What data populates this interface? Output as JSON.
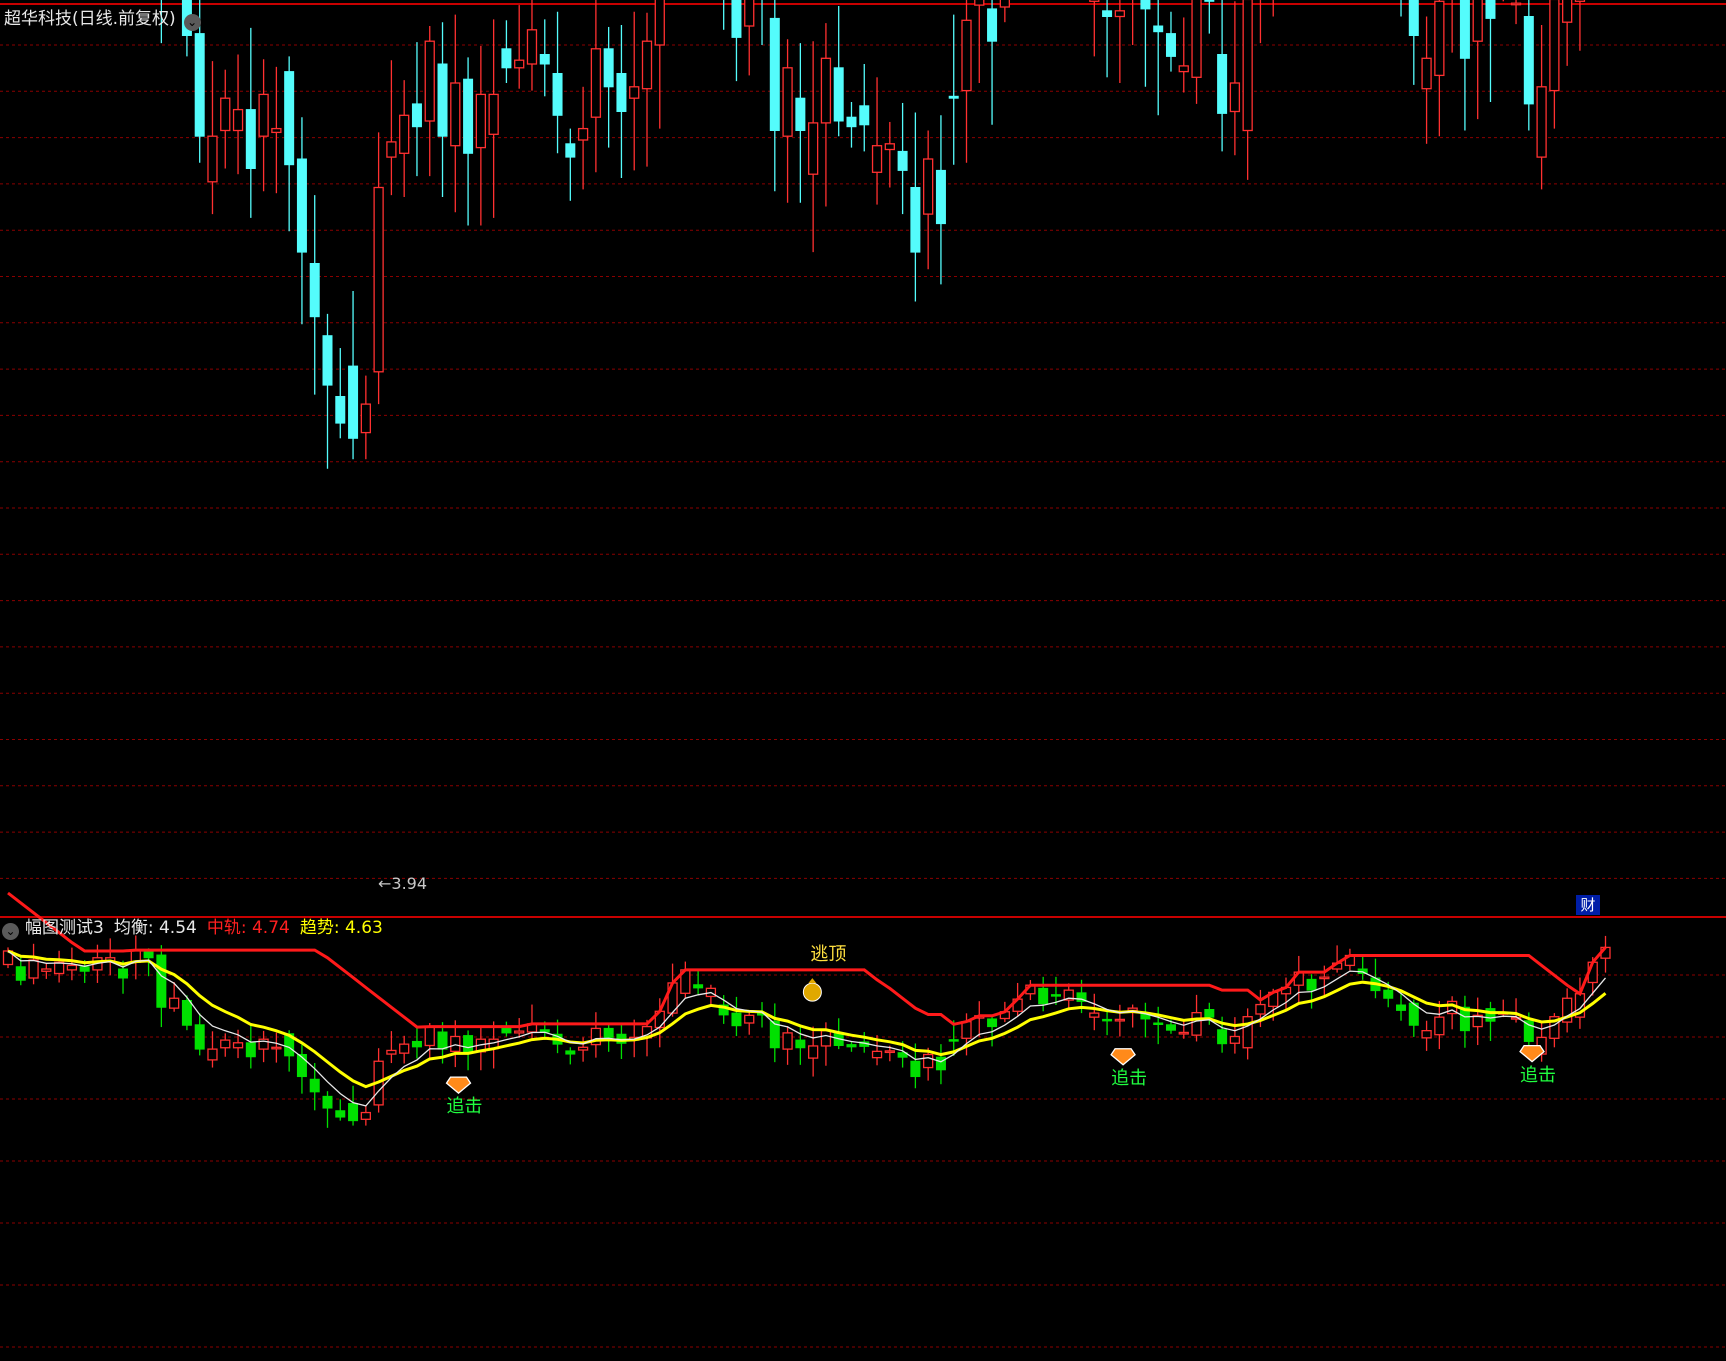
{
  "chart_data": [
    {
      "type": "candlestick",
      "title": "超华科技(日线.前复权)",
      "min_label": "3.94",
      "candles": [
        {
          "o": 5.9,
          "c": 6.2
        },
        {
          "o": 5.85,
          "c": 5.55
        },
        {
          "o": 5.6,
          "c": 6.0
        },
        {
          "o": 5.75,
          "c": 5.8
        },
        {
          "o": 5.7,
          "c": 5.95
        },
        {
          "o": 5.78,
          "c": 5.88
        },
        {
          "o": 5.85,
          "c": 5.75
        },
        {
          "o": 5.78,
          "c": 6.05
        },
        {
          "o": 5.98,
          "c": 6.05
        },
        {
          "o": 5.8,
          "c": 5.6
        },
        {
          "o": 5.95,
          "c": 6.22
        },
        {
          "o": 6.18,
          "c": 6.05
        },
        {
          "o": 6.11,
          "c": 4.95
        },
        {
          "o": 4.93,
          "c": 5.15
        },
        {
          "o": 5.1,
          "c": 4.55
        },
        {
          "o": 4.56,
          "c": 4.02
        },
        {
          "o": 3.78,
          "c": 4.02
        },
        {
          "o": 4.05,
          "c": 4.22
        },
        {
          "o": 4.05,
          "c": 4.16
        },
        {
          "o": 4.16,
          "c": 3.85
        },
        {
          "o": 4.02,
          "c": 4.24
        },
        {
          "o": 4.04,
          "c": 4.06
        },
        {
          "o": 4.36,
          "c": 3.87
        },
        {
          "o": 3.9,
          "c": 3.41
        },
        {
          "o": 3.35,
          "c": 3.07
        },
        {
          "o": 2.97,
          "c": 2.71
        },
        {
          "o": 2.65,
          "c": 2.51
        },
        {
          "o": 2.81,
          "c": 2.43
        },
        {
          "o": 2.46,
          "c": 2.61
        },
        {
          "o": 2.78,
          "c": 3.75
        },
        {
          "o": 3.91,
          "c": 3.99
        },
        {
          "o": 3.93,
          "c": 4.13
        },
        {
          "o": 4.19,
          "c": 4.07
        },
        {
          "o": 4.1,
          "c": 4.52
        },
        {
          "o": 4.4,
          "c": 4.02
        },
        {
          "o": 3.97,
          "c": 4.3
        },
        {
          "o": 4.32,
          "c": 3.93
        },
        {
          "o": 3.96,
          "c": 4.24
        },
        {
          "o": 4.03,
          "c": 4.24
        },
        {
          "o": 4.48,
          "c": 4.38
        },
        {
          "o": 4.38,
          "c": 4.42
        },
        {
          "o": 4.4,
          "c": 4.58
        },
        {
          "o": 4.45,
          "c": 4.4
        },
        {
          "o": 4.35,
          "c": 4.13
        },
        {
          "o": 3.98,
          "c": 3.91
        },
        {
          "o": 4.0,
          "c": 4.06
        },
        {
          "o": 4.12,
          "c": 4.48
        },
        {
          "o": 4.48,
          "c": 4.28
        },
        {
          "o": 4.35,
          "c": 4.15
        },
        {
          "o": 4.22,
          "c": 4.28
        },
        {
          "o": 4.27,
          "c": 4.52
        },
        {
          "o": 4.5,
          "c": 4.86
        },
        {
          "o": 4.82,
          "c": 5.49
        },
        {
          "o": 5.26,
          "c": 5.78
        },
        {
          "o": 5.45,
          "c": 5.38
        },
        {
          "o": 5.19,
          "c": 5.37
        },
        {
          "o": 5.0,
          "c": 4.78
        },
        {
          "o": 4.82,
          "c": 4.54
        },
        {
          "o": 4.6,
          "c": 4.77
        },
        {
          "o": 4.81,
          "c": 4.79
        },
        {
          "o": 4.64,
          "c": 4.05
        },
        {
          "o": 4.02,
          "c": 4.38
        },
        {
          "o": 4.22,
          "c": 4.05
        },
        {
          "o": 3.82,
          "c": 4.09
        },
        {
          "o": 4.09,
          "c": 4.43
        },
        {
          "o": 4.38,
          "c": 4.1
        },
        {
          "o": 4.12,
          "c": 4.07
        },
        {
          "o": 4.18,
          "c": 4.08
        },
        {
          "o": 3.83,
          "c": 3.97
        },
        {
          "o": 3.95,
          "c": 3.98
        },
        {
          "o": 3.94,
          "c": 3.84
        },
        {
          "o": 3.75,
          "c": 3.41
        },
        {
          "o": 3.61,
          "c": 3.9
        },
        {
          "o": 3.84,
          "c": 3.56
        },
        {
          "o": 4.23,
          "c": 4.22
        },
        {
          "o": 4.26,
          "c": 4.63
        },
        {
          "o": 4.71,
          "c": 4.76
        },
        {
          "o": 4.69,
          "c": 4.52
        },
        {
          "o": 4.7,
          "c": 4.85
        },
        {
          "o": 4.86,
          "c": 5.13
        },
        {
          "o": 5.25,
          "c": 5.44
        },
        {
          "o": 5.37,
          "c": 5.03
        },
        {
          "o": 5.23,
          "c": 5.2
        },
        {
          "o": 5.11,
          "c": 5.33
        },
        {
          "o": 5.27,
          "c": 5.08
        },
        {
          "o": 4.73,
          "c": 4.82
        },
        {
          "o": 4.68,
          "c": 4.65
        },
        {
          "o": 4.65,
          "c": 4.68
        },
        {
          "o": 4.88,
          "c": 4.93
        },
        {
          "o": 4.83,
          "c": 4.69
        },
        {
          "o": 4.6,
          "c": 4.57
        },
        {
          "o": 4.56,
          "c": 4.44
        },
        {
          "o": 4.36,
          "c": 4.39
        },
        {
          "o": 4.33,
          "c": 4.83
        },
        {
          "o": 4.9,
          "c": 4.73
        },
        {
          "o": 4.45,
          "c": 4.14
        },
        {
          "o": 4.15,
          "c": 4.3
        },
        {
          "o": 4.05,
          "c": 4.74
        },
        {
          "o": 4.8,
          "c": 5.01
        },
        {
          "o": 4.97,
          "c": 5.28
        },
        {
          "o": 5.25,
          "c": 5.39
        },
        {
          "o": 5.44,
          "c": 5.73
        },
        {
          "o": 5.57,
          "c": 5.33
        },
        {
          "o": 5.6,
          "c": 5.62
        },
        {
          "o": 5.8,
          "c": 5.93
        },
        {
          "o": 5.88,
          "c": 6.1
        },
        {
          "o": 5.8,
          "c": 5.7
        },
        {
          "o": 5.6,
          "c": 5.32
        },
        {
          "o": 5.33,
          "c": 5.15
        },
        {
          "o": 5.0,
          "c": 4.88
        },
        {
          "o": 5.04,
          "c": 4.55
        },
        {
          "o": 4.27,
          "c": 4.43
        },
        {
          "o": 4.34,
          "c": 4.73
        },
        {
          "o": 4.81,
          "c": 5.08
        },
        {
          "o": 4.95,
          "c": 4.43
        },
        {
          "o": 4.52,
          "c": 4.77
        },
        {
          "o": 4.92,
          "c": 4.64
        },
        {
          "o": 4.81,
          "c": 4.83
        },
        {
          "o": 4.72,
          "c": 4.72
        },
        {
          "o": 4.65,
          "c": 4.19
        },
        {
          "o": 3.91,
          "c": 4.28
        },
        {
          "o": 4.26,
          "c": 4.74
        },
        {
          "o": 4.62,
          "c": 5.15
        },
        {
          "o": 4.73,
          "c": 5.25
        },
        {
          "o": 5.5,
          "c": 5.95
        },
        {
          "o": 6.04,
          "c": 6.28
        }
      ]
    },
    {
      "type": "line",
      "title": "幅图测试3",
      "series": [
        {
          "name": "均衡",
          "value": "4.54",
          "color": "#e8e8e8"
        },
        {
          "name": "中轨",
          "value": "4.74",
          "color": "#ff2020"
        },
        {
          "name": "趋势",
          "value": "4.63",
          "color": "#ffff00"
        }
      ],
      "signals": [
        {
          "text": "逃顶",
          "bar": 62,
          "color": "#ffe040",
          "icon": "money-bag-icon"
        },
        {
          "text": "追击",
          "bar": 34,
          "color": "#20ff40",
          "icon": "gem-icon"
        },
        {
          "text": "追击",
          "bar": 86,
          "color": "#20ff40",
          "icon": "gem-icon"
        },
        {
          "text": "追击",
          "bar": 118,
          "color": "#20ff40",
          "icon": "gem-icon"
        }
      ]
    }
  ],
  "ui": {
    "title": "超华科技(日线.前复权)",
    "dropdown_glyph": "⌄",
    "collapse_glyph": "⌄",
    "indicator_name": "幅图测试3",
    "balance_label": "均衡:",
    "balance_value": "4.54",
    "mid_label": "中轨:",
    "mid_value": "4.74",
    "trend_label": "趋势:",
    "trend_value": "4.63",
    "cai_badge": "财",
    "low_label": "←3.94",
    "signal_escape": "逃顶",
    "signal_chase": "追击"
  },
  "colors": {
    "up": "#ff3030",
    "down": "#54fcfc",
    "down_lower": "#00e000",
    "up_lower": "#ff3030",
    "grid": "#8b0000",
    "sep": "#c80000"
  }
}
